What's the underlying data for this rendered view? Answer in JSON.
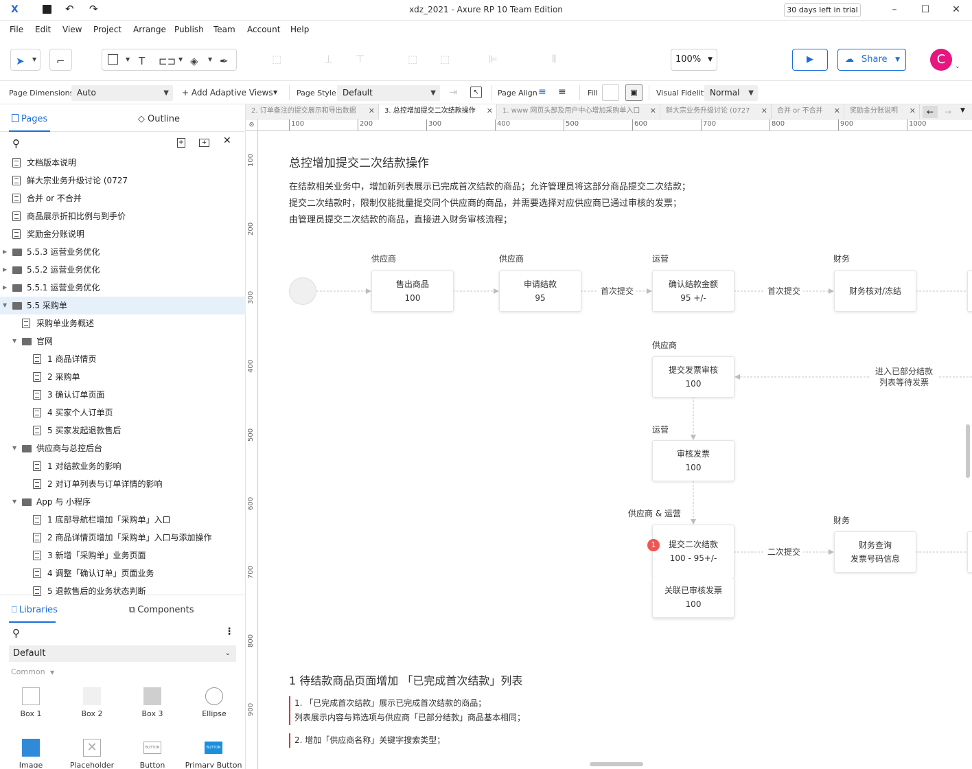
{
  "window": {
    "title": "xdz_2021 - Axure RP 10 Team Edition",
    "trial": "30 days left in trial"
  },
  "menu": [
    "File",
    "Edit",
    "View",
    "Project",
    "Arrange",
    "Publish",
    "Team",
    "Account",
    "Help"
  ],
  "toolbar": {
    "zoom": "100%",
    "share": "Share",
    "avatar": "C"
  },
  "stylebar": {
    "page_dimensions_label": "Page Dimensions",
    "page_dimensions_value": "Auto",
    "adaptive_views": "+ Add Adaptive Views",
    "page_style_label": "Page Style",
    "page_style_value": "Default",
    "page_align_label": "Page Align",
    "fill_label": "Fill",
    "visual_fidelity_label": "Visual Fidelity",
    "visual_fidelity_value": "Normal"
  },
  "left": {
    "tab_pages": "Pages",
    "tab_outline": "Outline",
    "pages": [
      {
        "label": "文档版本说明",
        "type": "flow"
      },
      {
        "label": "鲜大宗业务升级讨论 (0727",
        "type": "page"
      },
      {
        "label": "合并 or 不合并",
        "type": "page"
      },
      {
        "label": "商品展示折扣比例与到手价",
        "type": "page"
      },
      {
        "label": "奖励金分账说明",
        "type": "flow"
      },
      {
        "label": "5.5.3 运营业务优化",
        "type": "folder"
      },
      {
        "label": "5.5.2 运营业务优化",
        "type": "folder"
      },
      {
        "label": "5.5.1 运营业务优化",
        "type": "folder"
      },
      {
        "label": "5.5 采购单",
        "type": "folder"
      },
      {
        "label": "采购单业务概述",
        "type": "flow"
      },
      {
        "label": "官网",
        "type": "folder"
      },
      {
        "label": "1 商品详情页",
        "type": "page"
      },
      {
        "label": "2 采购单",
        "type": "page"
      },
      {
        "label": "3 确认订单页面",
        "type": "page"
      },
      {
        "label": "4 买家个人订单页",
        "type": "page"
      },
      {
        "label": "5 买家发起退款售后",
        "type": "page"
      },
      {
        "label": "供应商与总控后台",
        "type": "folder"
      },
      {
        "label": "1 对结款业务的影响",
        "type": "page"
      },
      {
        "label": "2 对订单列表与订单详情的影响",
        "type": "page"
      },
      {
        "label": "App 与 小程序",
        "type": "folder"
      },
      {
        "label": "1 底部导航栏增加「采购单」入口",
        "type": "page"
      },
      {
        "label": "2 商品详情页增加「采购单」入口与添加操作",
        "type": "page"
      },
      {
        "label": "3 新增「采购单」业务页面",
        "type": "page"
      },
      {
        "label": "4 调整「确认订单」页面业务",
        "type": "page"
      },
      {
        "label": "5 退款售后的业务状态判断",
        "type": "page"
      }
    ],
    "tab_libraries": "Libraries",
    "tab_components": "Components",
    "library": "Default",
    "group": "Common",
    "widgets": [
      "Box 1",
      "Box 2",
      "Box 3",
      "Ellipse",
      "Image",
      "Placeholder",
      "Button",
      "Primary Button"
    ]
  },
  "doctabs": [
    "2. 订单备注的提交展示和导出数据",
    "3. 总控增加提交二次结款操作",
    "1. www 网页头部及用户中心增加采购单入口",
    "鲜大宗业务升级讨论 (0727",
    "合并 or 不合并",
    "奖励金分账说明"
  ],
  "ruler": {
    "h": [
      "100",
      "200",
      "300",
      "400",
      "500",
      "600",
      "700",
      "800",
      "900",
      "1000"
    ],
    "v": [
      "100",
      "200",
      "300",
      "400",
      "500",
      "600",
      "700",
      "800",
      "900"
    ]
  },
  "canvas": {
    "title": "总控增加提交二次结款操作",
    "intro": [
      "在结款相关业务中，增加新列表展示已完成首次结款的商品；允许管理员将这部分商品提交二次结款；",
      "提交二次结款时，限制仅能批量提交同个供应商的商品，并需要选择对应供应商已通过审核的发票；",
      "由管理员提交二次结款的商品，直接进入财务审核流程；"
    ],
    "roles": {
      "r1": "供应商",
      "r2": "供应商",
      "r3": "运营",
      "r4": "财务",
      "r5": "供应商",
      "r6": "运营",
      "r7": "供应商 & 运营",
      "r8": "财务"
    },
    "boxes": {
      "b1": [
        "售出商品",
        "100"
      ],
      "b2": [
        "申请结款",
        "95"
      ],
      "b3": [
        "确认结款金额",
        "95 +/-"
      ],
      "b4": [
        "财务核对/冻结"
      ],
      "b5": [
        "提交发票审核",
        "100"
      ],
      "b6": [
        "审核发票",
        "100"
      ],
      "b7": [
        "提交二次结款",
        "100 - 95+/-"
      ],
      "b8": [
        "关联已审核发票",
        "100"
      ],
      "b9": [
        "财务查询",
        "发票号码信息"
      ]
    },
    "labels": {
      "l1": "首次提交",
      "l2": "首次提交",
      "l3a": "进入已部分结款",
      "l3b": "列表等待发票",
      "l4": "二次提交"
    },
    "badge": "1",
    "section_title": "1 待结款商品页面增加 「已完成首次结款」列表",
    "notes": [
      "1. 「已完成首次结款」展示已完成首次结款的商品；",
      "列表展示内容与筛选项与供应商「已部分结款」商品基本相同；",
      "2. 增加「供应商名称」关键字搜索类型；"
    ]
  }
}
